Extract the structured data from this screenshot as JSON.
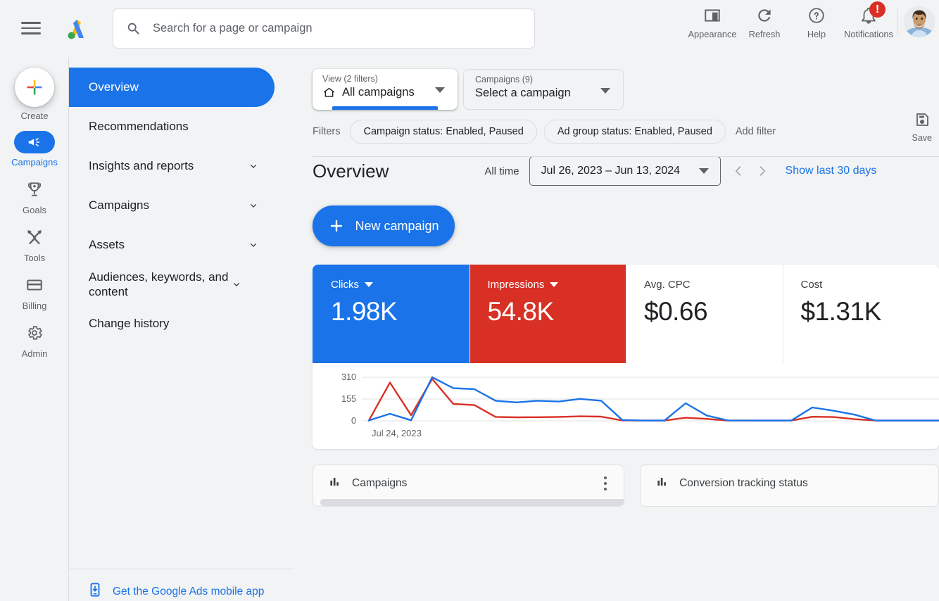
{
  "header": {
    "menu_label": "Main menu",
    "logo_label": "Google Ads",
    "search_placeholder": "Search for a page or campaign",
    "search_value": "",
    "actions": [
      {
        "label": "Appearance",
        "icon": "appearance-icon"
      },
      {
        "label": "Refresh",
        "icon": "refresh-icon"
      },
      {
        "label": "Help",
        "icon": "help-icon"
      },
      {
        "label": "Notifications",
        "icon": "bell-icon",
        "badge": "!"
      }
    ],
    "avatar_label": "Account avatar"
  },
  "rail": {
    "items": [
      {
        "label": "Create",
        "icon": "plus-icon",
        "active": false
      },
      {
        "label": "Campaigns",
        "icon": "megaphone-icon",
        "active": true
      },
      {
        "label": "Goals",
        "icon": "trophy-icon",
        "active": false
      },
      {
        "label": "Tools",
        "icon": "tools-icon",
        "active": false
      },
      {
        "label": "Billing",
        "icon": "credit-card-icon",
        "active": false
      },
      {
        "label": "Admin",
        "icon": "gear-icon",
        "active": false
      }
    ]
  },
  "sidenav": {
    "items": [
      {
        "label": "Overview",
        "active": true,
        "expandable": false
      },
      {
        "label": "Recommendations",
        "active": false,
        "expandable": false
      },
      {
        "label": "Insights and reports",
        "active": false,
        "expandable": true
      },
      {
        "label": "Campaigns",
        "active": false,
        "expandable": true
      },
      {
        "label": "Assets",
        "active": false,
        "expandable": true
      },
      {
        "label": "Audiences, keywords, and content",
        "active": false,
        "expandable": true
      },
      {
        "label": "Change history",
        "active": false,
        "expandable": false
      }
    ],
    "mobile_app_link": "Get the Google Ads mobile app"
  },
  "selectors": {
    "view": {
      "top_label": "View (2 filters)",
      "value": "All campaigns",
      "icon": "home-icon"
    },
    "campaign": {
      "top_label": "Campaigns (9)",
      "value": "Select a campaign"
    }
  },
  "filters": {
    "label": "Filters",
    "chips": [
      "Campaign status: Enabled, Paused",
      "Ad group status: Enabled, Paused"
    ],
    "add_filter": "Add filter",
    "save_label": "Save"
  },
  "page": {
    "title": "Overview",
    "range_label": "All time",
    "date_range": "Jul 26, 2023 – Jun 13, 2024",
    "prev_label": "Previous period",
    "next_label": "Next period",
    "show_last_30": "Show last 30 days",
    "new_campaign": "New campaign"
  },
  "scorecards": [
    {
      "label": "Clicks",
      "value": "1.98K",
      "style": "blue",
      "has_dropdown": true
    },
    {
      "label": "Impressions",
      "value": "54.8K",
      "style": "red",
      "has_dropdown": true
    },
    {
      "label": "Avg. CPC",
      "value": "$0.66",
      "style": "plain",
      "has_dropdown": false
    },
    {
      "label": "Cost",
      "value": "$1.31K",
      "style": "plain",
      "has_dropdown": false
    }
  ],
  "bottom_cards": [
    {
      "title": "Campaigns",
      "icon": "bar-chart-icon",
      "has_menu": true
    },
    {
      "title": "Conversion tracking status",
      "icon": "bar-chart-icon",
      "has_menu": false
    }
  ],
  "colors": {
    "accent_blue": "#1a73e8",
    "accent_red": "#d93025",
    "series_blue": "#1a73e8",
    "series_red": "#d93025",
    "page_bg": "#f1f3f4"
  },
  "chart_data": {
    "type": "line",
    "title": "",
    "xlabel": "",
    "ylabel": "",
    "x_tick_labels": [
      "Jul 24, 2023"
    ],
    "y_ticks": [
      0,
      155,
      310
    ],
    "ylim": [
      0,
      310
    ],
    "grid": true,
    "legend": "none",
    "series": [
      {
        "name": "Clicks",
        "color": "#1a73e8",
        "values": [
          3,
          50,
          4,
          310,
          232,
          225,
          143,
          131,
          143,
          137,
          156,
          143,
          6,
          2,
          2,
          125,
          38,
          3,
          2,
          2,
          2,
          95,
          72,
          44,
          2,
          2,
          2,
          2
        ]
      },
      {
        "name": "Impressions",
        "color": "#d93025",
        "values": [
          2,
          272,
          40,
          298,
          120,
          112,
          28,
          25,
          26,
          28,
          32,
          30,
          3,
          2,
          2,
          22,
          14,
          2,
          2,
          2,
          2,
          29,
          27,
          12,
          2,
          2,
          2,
          2
        ]
      }
    ]
  }
}
